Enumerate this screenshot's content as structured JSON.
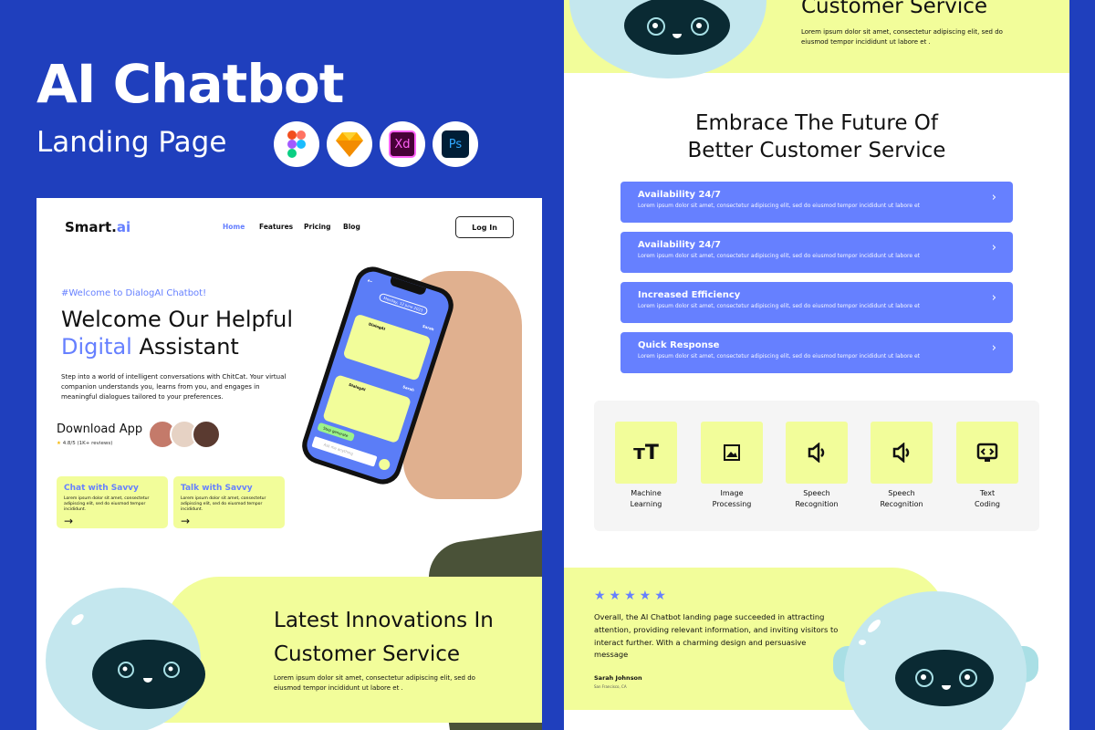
{
  "promo": {
    "title": "AI Chatbot",
    "subtitle": "Landing Page",
    "tools": [
      "figma-icon",
      "sketch-icon",
      "xd-icon",
      "photoshop-icon"
    ],
    "xd_label": "Xd",
    "ps_label": "Ps"
  },
  "colors": {
    "background": "#1f3fbd",
    "accent": "#6680ff",
    "yellow": "#f2fd9a",
    "robot": "#c4e7ee",
    "robot_face": "#0a2a33"
  },
  "header": {
    "logo_main": "Smart.",
    "logo_accent": "ai",
    "nav": [
      "Home",
      "Features",
      "Pricing",
      "Blog"
    ],
    "active": "Home",
    "login": "Log In"
  },
  "hero": {
    "tag": "#Welcome to DialogAI Chatbot!",
    "title_line1": "Welcome Our Helpful",
    "title_accent": "Digital",
    "title_rest": " Assistant",
    "description": "Step into a world of intelligent conversations with ChitCat. Your virtual companion understands you, learns from you, and engages in meaningful dialogues tailored to your preferences.",
    "download": "Download App",
    "rating": "4.8/5 (1K+ reviews)",
    "cards": [
      {
        "title": "Chat with Savvy",
        "text": "Lorem ipsum dolor sit amet, consectetur adipiscing elit, sed do eiusmod tempor incididunt."
      },
      {
        "title": "Talk with Savvy",
        "text": "Lorem ipsum dolor sit amet, consectetur adipiscing elit, sed do eiusmod tempor incididunt."
      }
    ]
  },
  "phone": {
    "date": "Monday, 12 June 2023",
    "user": "Sarah",
    "bot": "DialogAI",
    "stop": "Stop generate",
    "input_placeholder": "Ask me anything"
  },
  "innovations": {
    "title": "Latest Innovations In Customer Service",
    "right_title": "Customer Service",
    "text": "Lorem ipsum dolor sit amet, consectetur adipiscing elit, sed do eiusmod tempor incididunt ut labore et ."
  },
  "embrace": {
    "title_line1": "Embrace The Future Of",
    "title_line2": "Better Customer Service",
    "items": [
      {
        "title": "Availability 24/7",
        "text": "Lorem ipsum dolor sit amet, consectetur adipiscing elit, sed do eiusmod tempor incididunt ut labore et"
      },
      {
        "title": "Availability 24/7",
        "text": "Lorem ipsum dolor sit amet, consectetur adipiscing elit, sed do eiusmod tempor incididunt ut labore et"
      },
      {
        "title": "Increased Efficiency",
        "text": "Lorem ipsum dolor sit amet, consectetur adipiscing elit, sed do eiusmod tempor incididunt ut labore et"
      },
      {
        "title": "Quick Response",
        "text": "Lorem ipsum dolor sit amet, consectetur adipiscing elit, sed do eiusmod tempor incididunt ut labore et"
      }
    ]
  },
  "features": [
    {
      "line1": "Machine",
      "line2": "Learning",
      "icon": "text-size-icon"
    },
    {
      "line1": "Image",
      "line2": "Processing",
      "icon": "image-icon"
    },
    {
      "line1": "Speech",
      "line2": "Recognition",
      "icon": "speaker-icon"
    },
    {
      "line1": "Speech",
      "line2": "Recognition",
      "icon": "speaker-icon"
    },
    {
      "line1": "Text",
      "line2": "Coding",
      "icon": "code-monitor-icon"
    }
  ],
  "testimonial": {
    "stars": 5,
    "stars_text": "★★★★★",
    "quote": "Overall, the AI Chatbot landing page succeeded in attracting attention, providing relevant information, and inviting visitors to interact further. With a charming design and persuasive message",
    "name": "Sarah Johnson",
    "location": "San Francisco, CA"
  }
}
